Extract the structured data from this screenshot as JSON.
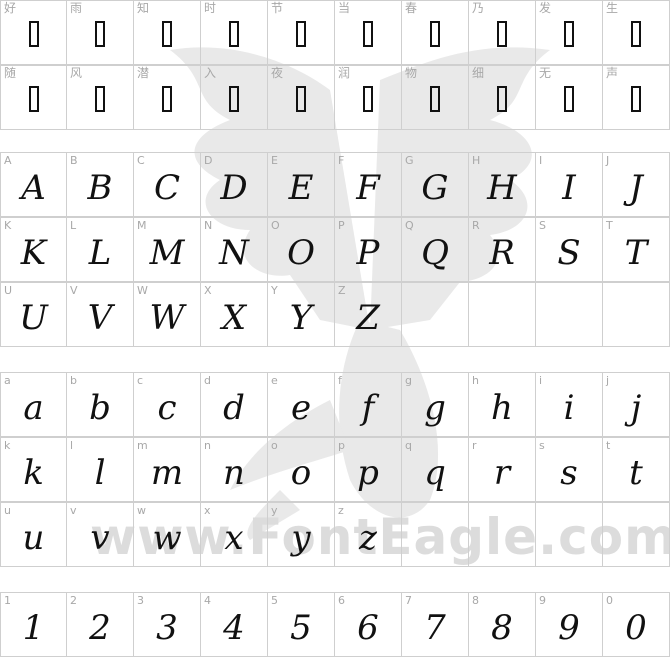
{
  "watermark": {
    "text": "www.FontEagle.com",
    "icon": "eagle"
  },
  "cjk_rows": [
    [
      "好",
      "雨",
      "知",
      "时",
      "节",
      "当",
      "春",
      "乃",
      "发",
      "生"
    ],
    [
      "随",
      "风",
      "潜",
      "入",
      "夜",
      "润",
      "物",
      "细",
      "无",
      "声"
    ]
  ],
  "uppercase_rows": [
    [
      "A",
      "B",
      "C",
      "D",
      "E",
      "F",
      "G",
      "H",
      "I",
      "J"
    ],
    [
      "K",
      "L",
      "M",
      "N",
      "O",
      "P",
      "Q",
      "R",
      "S",
      "T"
    ],
    [
      "U",
      "V",
      "W",
      "X",
      "Y",
      "Z"
    ]
  ],
  "lowercase_rows": [
    [
      "a",
      "b",
      "c",
      "d",
      "e",
      "f",
      "g",
      "h",
      "i",
      "j"
    ],
    [
      "k",
      "l",
      "m",
      "n",
      "o",
      "p",
      "q",
      "r",
      "s",
      "t"
    ],
    [
      "u",
      "v",
      "w",
      "x",
      "y",
      "z"
    ]
  ],
  "digit_rows": [
    [
      "1",
      "2",
      "3",
      "4",
      "5",
      "6",
      "7",
      "8",
      "9",
      "0"
    ]
  ]
}
